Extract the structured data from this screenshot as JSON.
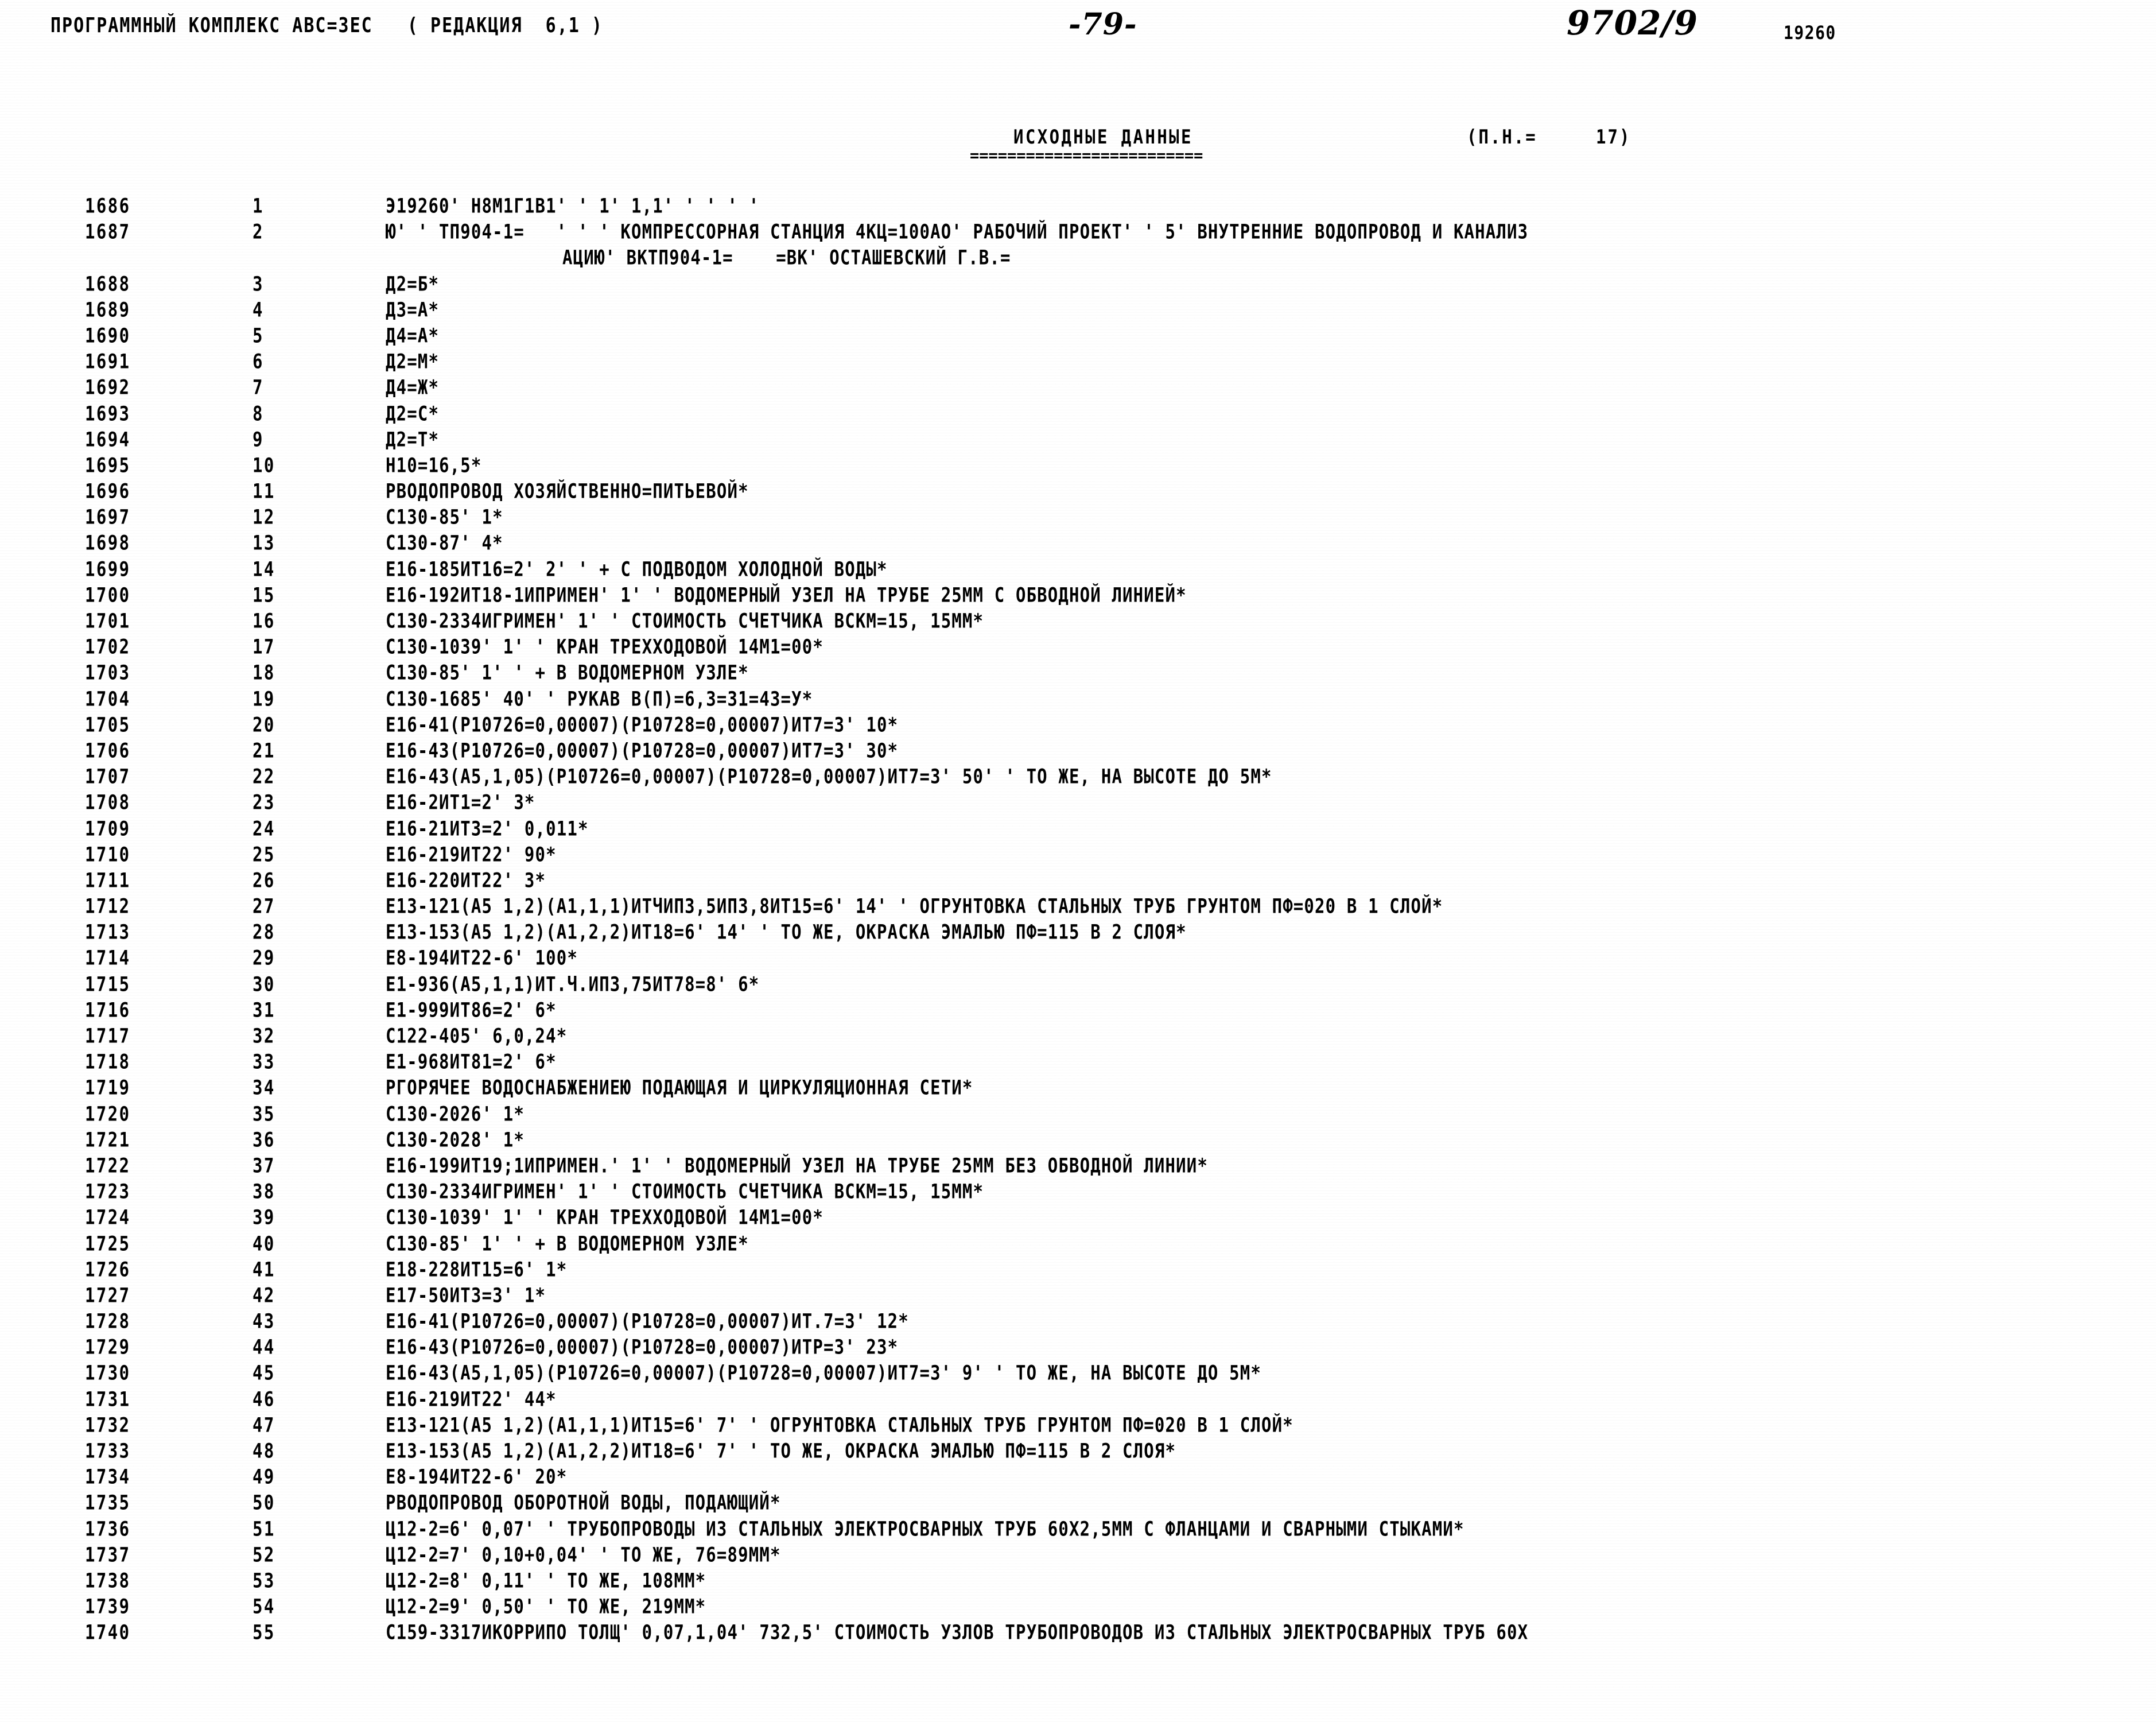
{
  "header": {
    "program_title": "ПРОГРАММНЫЙ КОМПЛЕКС АВС=ЗЕС   ( РЕДАКЦИЯ  6,1 )",
    "page_number": "-79-",
    "doc_code": "9702/9",
    "object_code": "19260",
    "section_title": "ИСХОДНЫЕ ДАННЫЕ",
    "section_rule": "=========================",
    "pn_label": "(П.Н.=     17)"
  },
  "listing": {
    "rows": [
      {
        "seq": "1686",
        "num": "1",
        "text": "Э19260' Н8М1Г1В1' ' 1' 1,1' ' ' ' '",
        "cont": false
      },
      {
        "seq": "1687",
        "num": "2",
        "text": "Ю' ' ТП904-1=   ' ' ' КОМПРЕССОРНАЯ СТАНЦИЯ 4КЦ=100АО' РАБОЧИЙ ПРОЕКТ' ' 5' ВНУТРЕННИЕ ВОДОПРОВОД И КАНАЛИЗ",
        "cont": false
      },
      {
        "seq": "",
        "num": "",
        "text": "АЦИЮ' ВКТП904-1=    =ВК' ОСТАШЕВСКИЙ Г.В.=",
        "cont": true
      },
      {
        "seq": "1688",
        "num": "3",
        "text": "Д2=Б*",
        "cont": false
      },
      {
        "seq": "1689",
        "num": "4",
        "text": "Д3=А*",
        "cont": false
      },
      {
        "seq": "1690",
        "num": "5",
        "text": "Д4=А*",
        "cont": false
      },
      {
        "seq": "1691",
        "num": "6",
        "text": "Д2=М*",
        "cont": false
      },
      {
        "seq": "1692",
        "num": "7",
        "text": "Д4=Ж*",
        "cont": false
      },
      {
        "seq": "1693",
        "num": "8",
        "text": "Д2=С*",
        "cont": false
      },
      {
        "seq": "1694",
        "num": "9",
        "text": "Д2=Т*",
        "cont": false
      },
      {
        "seq": "1695",
        "num": "10",
        "text": "Н10=16,5*",
        "cont": false
      },
      {
        "seq": "1696",
        "num": "11",
        "text": "РВОДОПРОВОД ХОЗЯЙСТВЕННО=ПИТЬЕВОЙ*",
        "cont": false
      },
      {
        "seq": "1697",
        "num": "12",
        "text": "С130-85' 1*",
        "cont": false
      },
      {
        "seq": "1698",
        "num": "13",
        "text": "С130-87' 4*",
        "cont": false
      },
      {
        "seq": "1699",
        "num": "14",
        "text": "Е16-185ИТ16=2' 2' ' + С ПОДВОДОМ ХОЛОДНОЙ ВОДЫ*",
        "cont": false
      },
      {
        "seq": "1700",
        "num": "15",
        "text": "Е16-192ИТ18-1ИПРИМЕН' 1' ' ВОДОМЕРНЫЙ УЗЕЛ НА ТРУБЕ 25ММ С ОБВОДНОЙ ЛИНИЕЙ*",
        "cont": false
      },
      {
        "seq": "1701",
        "num": "16",
        "text": "С130-2334ИГРИМЕН' 1' ' СТОИМОСТЬ СЧЕТЧИКА ВСКМ=15, 15ММ*",
        "cont": false
      },
      {
        "seq": "1702",
        "num": "17",
        "text": "С130-1039' 1' ' КРАН ТРЕХХОДОВОЙ 14М1=00*",
        "cont": false
      },
      {
        "seq": "1703",
        "num": "18",
        "text": "С130-85' 1' ' + В ВОДОМЕРНОМ УЗЛЕ*",
        "cont": false
      },
      {
        "seq": "1704",
        "num": "19",
        "text": "С130-1685' 40' ' РУКАВ В(П)=6,3=31=43=У*",
        "cont": false
      },
      {
        "seq": "1705",
        "num": "20",
        "text": "Е16-41(Р10726=0,00007)(Р10728=0,00007)ИТ7=3' 10*",
        "cont": false
      },
      {
        "seq": "1706",
        "num": "21",
        "text": "Е16-43(Р10726=0,00007)(Р10728=0,00007)ИТ7=3' 30*",
        "cont": false
      },
      {
        "seq": "1707",
        "num": "22",
        "text": "Е16-43(А5,1,05)(Р10726=0,00007)(Р10728=0,00007)ИТ7=3' 50' ' ТО ЖЕ, НА ВЫСОТЕ ДО 5М*",
        "cont": false
      },
      {
        "seq": "1708",
        "num": "23",
        "text": "Е16-2ИТ1=2' 3*",
        "cont": false
      },
      {
        "seq": "1709",
        "num": "24",
        "text": "Е16-21ИТ3=2' 0,011*",
        "cont": false
      },
      {
        "seq": "1710",
        "num": "25",
        "text": "Е16-219ИТ22' 90*",
        "cont": false
      },
      {
        "seq": "1711",
        "num": "26",
        "text": "Е16-220ИТ22' 3*",
        "cont": false
      },
      {
        "seq": "1712",
        "num": "27",
        "text": "Е13-121(А5 1,2)(А1,1,1)ИТЧИП3,5ИП3,8ИТ15=6' 14' ' ОГРУНТОВКА СТАЛЬНЫХ ТРУБ ГРУНТОМ ПФ=020 В 1 СЛОЙ*",
        "cont": false
      },
      {
        "seq": "1713",
        "num": "28",
        "text": "Е13-153(А5 1,2)(А1,2,2)ИТ18=6' 14' ' ТО ЖЕ, ОКРАСКА ЭМАЛЬЮ ПФ=115 В 2 СЛОЯ*",
        "cont": false
      },
      {
        "seq": "1714",
        "num": "29",
        "text": "Е8-194ИТ22-6' 100*",
        "cont": false
      },
      {
        "seq": "1715",
        "num": "30",
        "text": "Е1-936(А5,1,1)ИТ.Ч.ИП3,75ИТ78=8' 6*",
        "cont": false
      },
      {
        "seq": "1716",
        "num": "31",
        "text": "Е1-999ИТ86=2' 6*",
        "cont": false
      },
      {
        "seq": "1717",
        "num": "32",
        "text": "С122-405' 6,0,24*",
        "cont": false
      },
      {
        "seq": "1718",
        "num": "33",
        "text": "Е1-968ИТ81=2' 6*",
        "cont": false
      },
      {
        "seq": "1719",
        "num": "34",
        "text": "РГОРЯЧЕЕ ВОДОСНАБЖЕНИЕЮ ПОДАЮЩАЯ И ЦИРКУЛЯЦИОННАЯ СЕТИ*",
        "cont": false
      },
      {
        "seq": "1720",
        "num": "35",
        "text": "С130-2026' 1*",
        "cont": false
      },
      {
        "seq": "1721",
        "num": "36",
        "text": "С130-2028' 1*",
        "cont": false
      },
      {
        "seq": "1722",
        "num": "37",
        "text": "Е16-199ИТ19;1ИПРИМЕН.' 1' ' ВОДОМЕРНЫЙ УЗЕЛ НА ТРУБЕ 25ММ БЕЗ ОБВОДНОЙ ЛИНИИ*",
        "cont": false
      },
      {
        "seq": "1723",
        "num": "38",
        "text": "С130-2334ИГРИМЕН' 1' ' СТОИМОСТЬ СЧЕТЧИКА ВСКМ=15, 15ММ*",
        "cont": false
      },
      {
        "seq": "1724",
        "num": "39",
        "text": "С130-1039' 1' ' КРАН ТРЕХХОДОВОЙ 14М1=00*",
        "cont": false
      },
      {
        "seq": "1725",
        "num": "40",
        "text": "С130-85' 1' ' + В ВОДОМЕРНОМ УЗЛЕ*",
        "cont": false
      },
      {
        "seq": "1726",
        "num": "41",
        "text": "Е18-228ИТ15=6' 1*",
        "cont": false
      },
      {
        "seq": "1727",
        "num": "42",
        "text": "Е17-50ИТ3=3' 1*",
        "cont": false
      },
      {
        "seq": "1728",
        "num": "43",
        "text": "Е16-41(Р10726=0,00007)(Р10728=0,00007)ИТ.7=3' 12*",
        "cont": false
      },
      {
        "seq": "1729",
        "num": "44",
        "text": "Е16-43(Р10726=0,00007)(Р10728=0,00007)ИТР=3' 23*",
        "cont": false
      },
      {
        "seq": "1730",
        "num": "45",
        "text": "Е16-43(А5,1,05)(Р10726=0,00007)(Р10728=0,00007)ИТ7=3' 9' ' ТО ЖЕ, НА ВЫСОТЕ ДО 5М*",
        "cont": false
      },
      {
        "seq": "1731",
        "num": "46",
        "text": "Е16-219ИТ22' 44*",
        "cont": false
      },
      {
        "seq": "1732",
        "num": "47",
        "text": "Е13-121(А5 1,2)(А1,1,1)ИТ15=6' 7' ' ОГРУНТОВКА СТАЛЬНЫХ ТРУБ ГРУНТОМ ПФ=020 В 1 СЛОЙ*",
        "cont": false
      },
      {
        "seq": "1733",
        "num": "48",
        "text": "Е13-153(А5 1,2)(А1,2,2)ИТ18=6' 7' ' ТО ЖЕ, ОКРАСКА ЭМАЛЬЮ ПФ=115 В 2 СЛОЯ*",
        "cont": false
      },
      {
        "seq": "1734",
        "num": "49",
        "text": "Е8-194ИТ22-6' 20*",
        "cont": false
      },
      {
        "seq": "1735",
        "num": "50",
        "text": "РВОДОПРОВОД ОБОРОТНОЙ ВОДЫ, ПОДАЮЩИЙ*",
        "cont": false
      },
      {
        "seq": "1736",
        "num": "51",
        "text": "Ц12-2=6' 0,07' ' ТРУБОПРОВОДЫ ИЗ СТАЛЬНЫХ ЭЛЕКТРОСВАРНЫХ ТРУБ 60Х2,5ММ С ФЛАНЦАМИ И СВАРНЫМИ СТЫКАМИ*",
        "cont": false
      },
      {
        "seq": "1737",
        "num": "52",
        "text": "Ц12-2=7' 0,10+0,04' ' ТО ЖЕ, 76=89ММ*",
        "cont": false
      },
      {
        "seq": "1738",
        "num": "53",
        "text": "Ц12-2=8' 0,11' ' ТО ЖЕ, 108ММ*",
        "cont": false
      },
      {
        "seq": "1739",
        "num": "54",
        "text": "Ц12-2=9' 0,50' ' ТО ЖЕ, 219ММ*",
        "cont": false
      },
      {
        "seq": "1740",
        "num": "55",
        "text": "С159-3317ИКОРРИПО ТОЛЩ' 0,07,1,04' 732,5' СТОИМОСТЬ УЗЛОВ ТРУБОПРОВОДОВ ИЗ СТАЛЬНЫХ ЭЛЕКТРОСВАРНЫХ ТРУБ 60Х",
        "cont": false
      }
    ]
  }
}
